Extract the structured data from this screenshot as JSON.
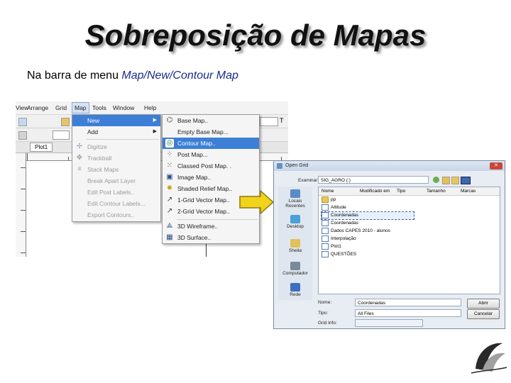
{
  "slide": {
    "title": "Sobreposição de Mapas",
    "subtitle_prefix": "Na barra de menu ",
    "subtitle_path": "Map/New/Contour Map"
  },
  "app": {
    "menubar": [
      "View",
      "Arrange",
      "Grid",
      "Map",
      "Tools",
      "Window",
      "Help"
    ],
    "selected_menu": "Map",
    "plot_tab": "Plot1",
    "map_menu": {
      "items": [
        {
          "label": "New",
          "icon": "",
          "disabled": false,
          "submenu": true,
          "highlight": true
        },
        {
          "label": "Add",
          "icon": "",
          "disabled": false,
          "submenu": true,
          "highlight": false
        },
        {
          "label": "Digitize",
          "icon": "digitize-icon",
          "disabled": true
        },
        {
          "label": "Trackball",
          "icon": "trackball-icon",
          "disabled": true
        },
        {
          "label": "Stack Maps",
          "icon": "stack-maps-icon",
          "disabled": true
        },
        {
          "label": "Break Apart Layer",
          "icon": "",
          "disabled": true
        },
        {
          "label": "Edit Post Labels..",
          "icon": "",
          "disabled": true
        },
        {
          "label": "Edit Contour Labels...",
          "icon": "",
          "disabled": true
        },
        {
          "label": "Export Contours..",
          "icon": "",
          "disabled": true
        }
      ]
    },
    "new_submenu": {
      "items": [
        {
          "label": "Base Map..",
          "icon": "base-map-icon",
          "highlight": false
        },
        {
          "label": "Empty Base Map...",
          "icon": "",
          "highlight": false
        },
        {
          "label": "Contour Map..",
          "icon": "contour-map-icon",
          "highlight": true
        },
        {
          "label": "Post Map...",
          "icon": "post-map-icon",
          "highlight": false
        },
        {
          "label": "Classed Post Map. .",
          "icon": "classed-post-map-icon",
          "highlight": false
        },
        {
          "label": "Image Map..",
          "icon": "image-map-icon",
          "highlight": false
        },
        {
          "label": "Shaded Relief Map..",
          "icon": "shaded-relief-icon",
          "highlight": false
        },
        {
          "label": "1-Grid Vector Map..",
          "icon": "vector-map-icon",
          "highlight": false
        },
        {
          "label": "2-Grid Vector Map..",
          "icon": "vector-map-2-icon",
          "highlight": false
        },
        {
          "label": "3D Wireframe..",
          "icon": "wireframe-icon",
          "highlight": false
        },
        {
          "label": "3D Surface..",
          "icon": "surface-icon",
          "highlight": false
        }
      ]
    }
  },
  "dialog": {
    "title": "Open Grid",
    "look_in_label": "Examinar:",
    "look_in_value": "SIG_AGRO (:)",
    "places": [
      "Locais Recentes",
      "Desktop",
      "Sheila",
      "Computador",
      "Rede"
    ],
    "columns": [
      "Nome",
      "Modificado em",
      "Tipo",
      "Tamanho",
      "Marcas"
    ],
    "files": [
      {
        "name": "pp",
        "kind": "folder",
        "selected": false
      },
      {
        "name": "Altitude",
        "kind": "doc",
        "selected": false
      },
      {
        "name": "Coordenadas",
        "kind": "doc",
        "selected": true
      },
      {
        "name": "Coordenadas",
        "kind": "doc",
        "selected": false
      },
      {
        "name": "Dados CAPES 2010 - alunos",
        "kind": "doc",
        "selected": false
      },
      {
        "name": "Interpolação",
        "kind": "doc",
        "selected": false
      },
      {
        "name": "Plot1",
        "kind": "doc",
        "selected": false
      },
      {
        "name": "QUESTÕES",
        "kind": "doc",
        "selected": false
      }
    ],
    "filename_label": "Nome:",
    "filename_value": "Coordenadas",
    "type_label": "Tipo:",
    "type_value": "All Files",
    "open_label": "Abrir",
    "cancel_label": "Cancelar",
    "fileinfo_label": "Grid Info:"
  },
  "colors": {
    "highlight": "#3d7fd6",
    "arrow_fill": "#f2d21b",
    "arrow_stroke": "#8a7a10",
    "subtitle_path": "#1a2a8a"
  }
}
